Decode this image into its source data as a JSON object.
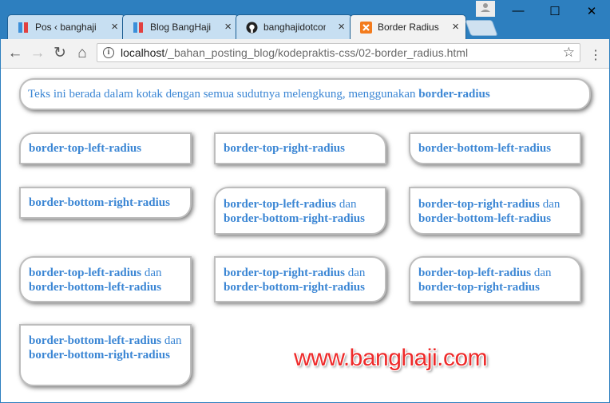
{
  "browser": {
    "tabs": [
      {
        "title": "Pos ‹ banghaji",
        "close": "×"
      },
      {
        "title": "Blog BangHaji",
        "close": "×"
      },
      {
        "title": "banghajidotcom",
        "close": "×"
      },
      {
        "title": "Border Radius",
        "close": "×"
      }
    ],
    "window_controls": {
      "minimize": "—",
      "maximize": "☐",
      "close": "✕"
    },
    "url_host": "localhost",
    "url_path": "/_bahan_posting_blog/kodepraktis-css/02-border_radius.html"
  },
  "page": {
    "intro": {
      "text": "Teks ini berada dalam kotak dengan semua sudutnya melengkung, menggunakan ",
      "bold": "border-radius"
    },
    "boxes": [
      {
        "a": "border-top-left-radius"
      },
      {
        "a": "border-top-right-radius"
      },
      {
        "a": "border-bottom-left-radius"
      },
      {
        "a": "border-bottom-right-radius"
      },
      {
        "a": "border-top-left-radius",
        "joiner": " dan ",
        "b": "border-bottom-right-radius"
      },
      {
        "a": "border-top-right-radius",
        "joiner": " dan ",
        "b": "border-bottom-left-radius"
      },
      {
        "a": "border-top-left-radius",
        "joiner": " dan ",
        "b": "border-bottom-left-radius"
      },
      {
        "a": "border-top-right-radius",
        "joiner": " dan ",
        "b": "border-bottom-right-radius"
      },
      {
        "a": "border-top-left-radius",
        "joiner": " dan ",
        "b": "border-top-right-radius"
      },
      {
        "a": "border-bottom-left-radius",
        "joiner": " dan ",
        "b": "border-bottom-right-radius"
      }
    ],
    "watermark": "www.banghaji.com"
  }
}
